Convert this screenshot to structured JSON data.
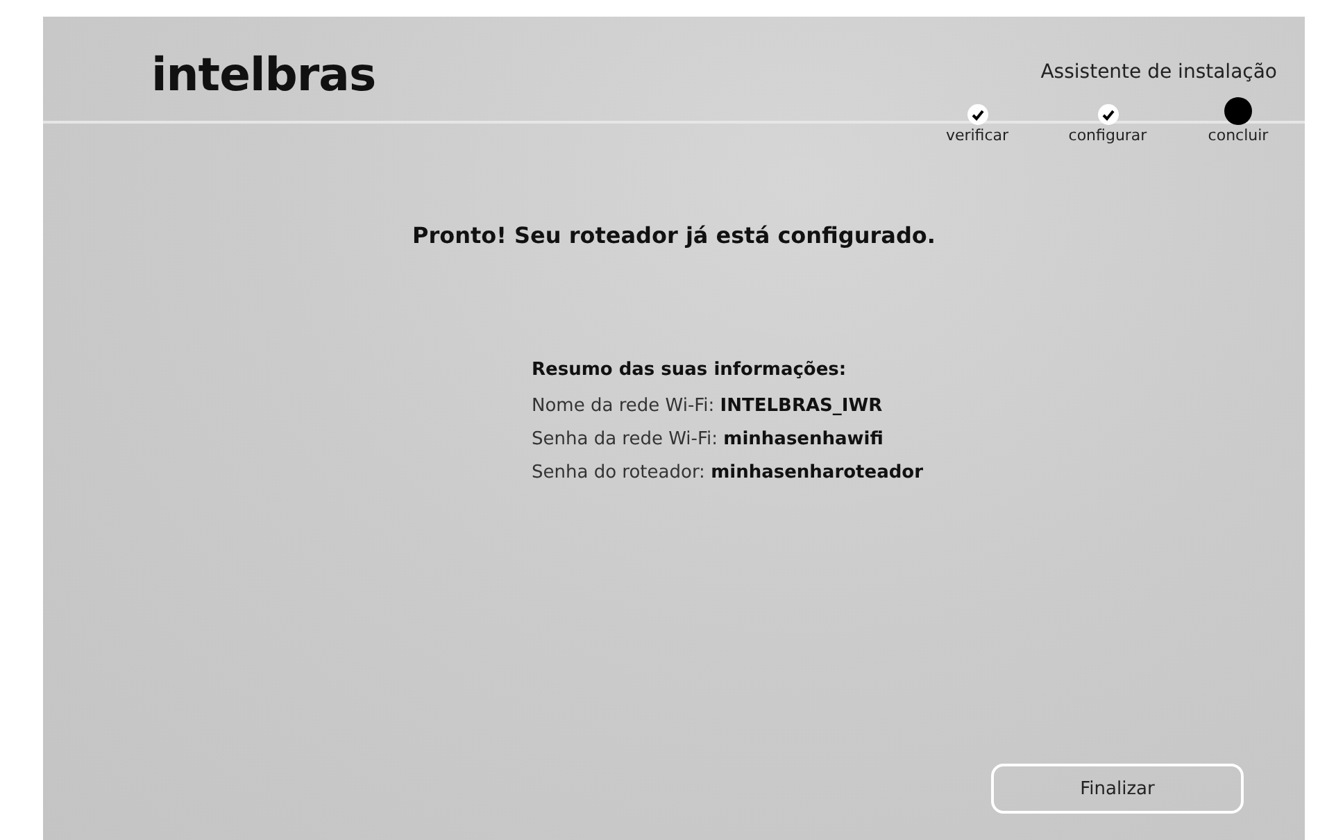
{
  "logo": "intelbras",
  "wizard_title": "Assistente de instalação",
  "steps": [
    {
      "label": "verificar",
      "completed": true
    },
    {
      "label": "configurar",
      "completed": true
    },
    {
      "label": "concluir",
      "completed": false
    }
  ],
  "heading": "Pronto! Seu roteador já está configurado.",
  "summary": {
    "title": "Resumo das suas informações:",
    "lines": [
      "Nome da rede Wi-Fi: **INTELBRAS_IWR**",
      "Senha da rede Wi-Fi: **minhasenhawifi**",
      "Senha do roteador: **minhasenharoteador**"
    ]
  },
  "button": "Finalizar"
}
